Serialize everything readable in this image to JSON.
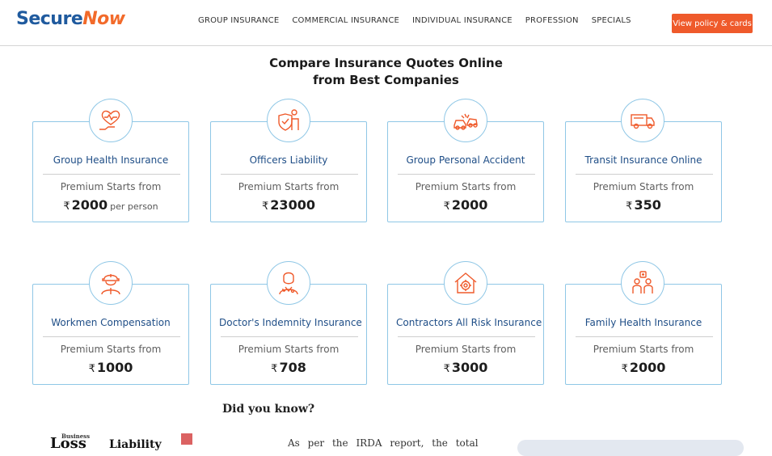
{
  "header": {
    "logo": {
      "part1": "Secure",
      "part2": "Now"
    },
    "nav": [
      "GROUP INSURANCE",
      "COMMERCIAL INSURANCE",
      "INDIVIDUAL INSURANCE",
      "PROFESSION",
      "SPECIALS"
    ],
    "cta_label": "View policy & cards"
  },
  "main": {
    "heading_line1": "Compare Insurance Quotes Online",
    "heading_line2": "from Best Companies",
    "cards": [
      {
        "title": "Group Health Insurance",
        "sub": "Premium Starts from",
        "currency": "₹",
        "amount": "2000",
        "unit": "per person",
        "icon": "heart-hand-icon"
      },
      {
        "title": "Officers Liability",
        "sub": "Premium Starts from",
        "currency": "₹",
        "amount": "23000",
        "unit": "",
        "icon": "shield-person-icon"
      },
      {
        "title": "Group Personal Accident",
        "sub": "Premium Starts from",
        "currency": "₹",
        "amount": "2000",
        "unit": "",
        "icon": "car-accident-icon"
      },
      {
        "title": "Transit Insurance Online",
        "sub": "Premium Starts from",
        "currency": "₹",
        "amount": "350",
        "unit": "",
        "icon": "truck-icon"
      },
      {
        "title": "Workmen Compensation",
        "sub": "Premium Starts from",
        "currency": "₹",
        "amount": "1000",
        "unit": "",
        "icon": "worker-helmet-icon"
      },
      {
        "title": "Doctor's Indemnity Insurance",
        "sub": "Premium Starts from",
        "currency": "₹",
        "amount": "708",
        "unit": "",
        "icon": "doctor-icon"
      },
      {
        "title": "Contractors All Risk Insurance",
        "sub": "Premium Starts from",
        "currency": "₹",
        "amount": "3000",
        "unit": "",
        "icon": "house-gear-icon"
      },
      {
        "title": "Family Health Insurance",
        "sub": "Premium Starts from",
        "currency": "₹",
        "amount": "2000",
        "unit": "",
        "icon": "family-icon"
      }
    ],
    "did_you_know": "Did you know?",
    "snippet_small": "Business",
    "snippet_big": "Loss",
    "snippet_mid": "Liability",
    "snippet_text": "As per the IRDA report, the total"
  },
  "colors": {
    "brand_blue": "#1f5a9e",
    "brand_orange": "#f26a2a",
    "cta": "#ef5a2b",
    "card_border": "#8fc7e6",
    "title_blue": "#1f4e87"
  }
}
